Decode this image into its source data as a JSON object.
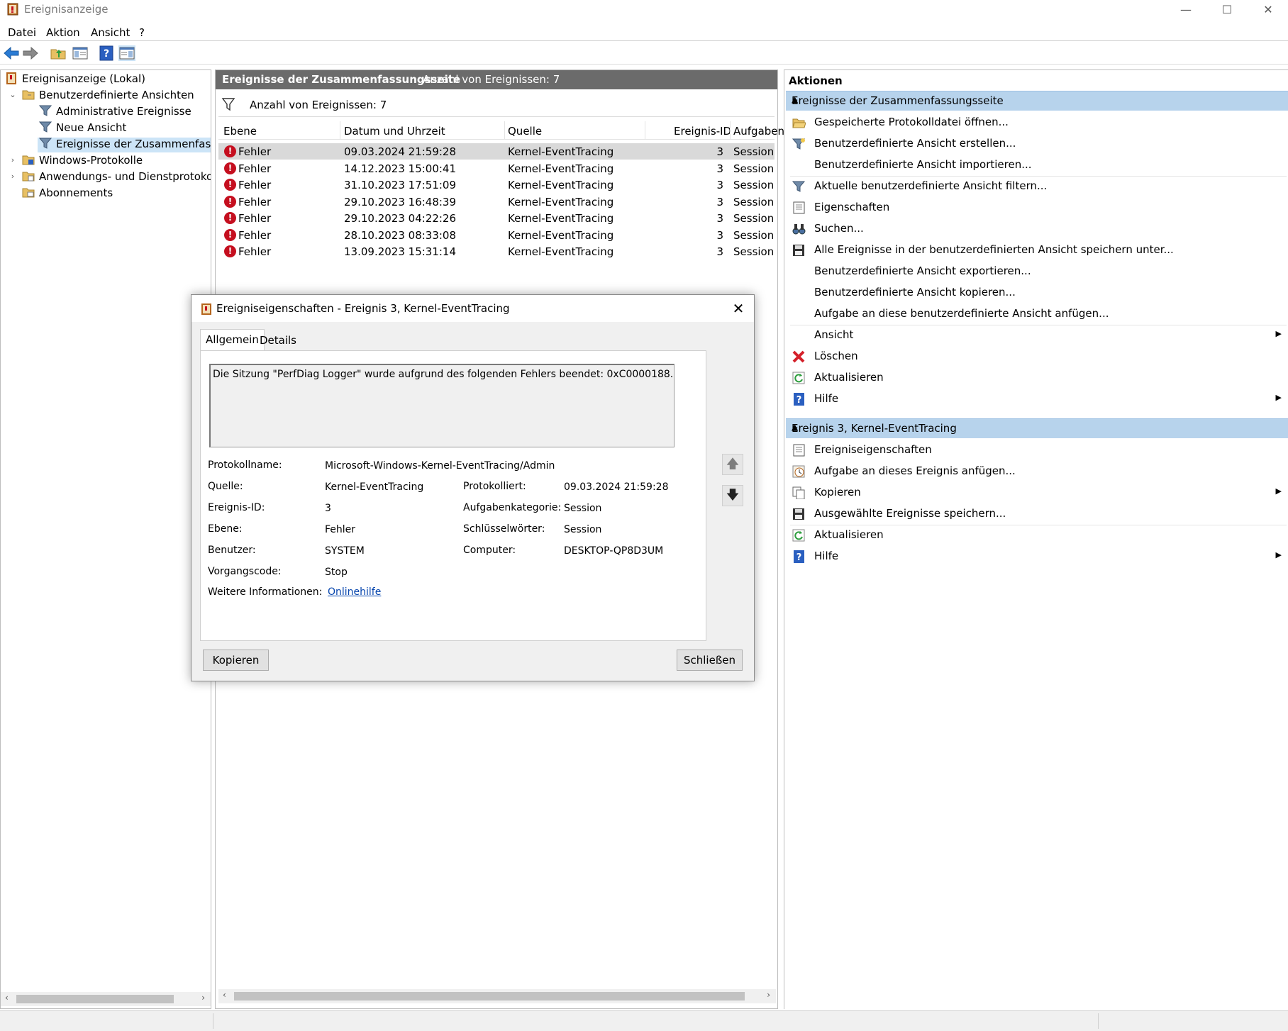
{
  "window": {
    "title": "Ereignisanzeige",
    "minimize_glyph": "—",
    "maximize_glyph": "☐",
    "close_glyph": "✕"
  },
  "menu": [
    "Datei",
    "Aktion",
    "Ansicht",
    "?"
  ],
  "tree": {
    "root": "Ereignisanzeige (Lokal)",
    "custom_views": "Benutzerdefinierte Ansichten",
    "admin_events": "Administrative Ereignisse",
    "new_view": "Neue Ansicht",
    "summary_events": "Ereignisse der Zusammenfassung",
    "windows_logs": "Windows-Protokolle",
    "app_logs": "Anwendungs- und Dienstprotokolle",
    "subscriptions": "Abonnements"
  },
  "middle": {
    "header_title": "Ereignisse der Zusammenfassungsseite",
    "header_count": "Anzahl von Ereignissen: 7",
    "filter_text": "Anzahl von Ereignissen: 7",
    "columns": [
      "Ebene",
      "Datum und Uhrzeit",
      "Quelle",
      "Ereignis-ID",
      "Aufgaben"
    ],
    "rows": [
      {
        "level": "Fehler",
        "datetime": "09.03.2024 21:59:28",
        "source": "Kernel-EventTracing",
        "id": "3",
        "task": "Session"
      },
      {
        "level": "Fehler",
        "datetime": "14.12.2023 15:00:41",
        "source": "Kernel-EventTracing",
        "id": "3",
        "task": "Session"
      },
      {
        "level": "Fehler",
        "datetime": "31.10.2023 17:51:09",
        "source": "Kernel-EventTracing",
        "id": "3",
        "task": "Session"
      },
      {
        "level": "Fehler",
        "datetime": "29.10.2023 16:48:39",
        "source": "Kernel-EventTracing",
        "id": "3",
        "task": "Session"
      },
      {
        "level": "Fehler",
        "datetime": "29.10.2023 04:22:26",
        "source": "Kernel-EventTracing",
        "id": "3",
        "task": "Session"
      },
      {
        "level": "Fehler",
        "datetime": "28.10.2023 08:33:08",
        "source": "Kernel-EventTracing",
        "id": "3",
        "task": "Session"
      },
      {
        "level": "Fehler",
        "datetime": "13.09.2023 15:31:14",
        "source": "Kernel-EventTracing",
        "id": "3",
        "task": "Session"
      }
    ]
  },
  "actions": {
    "header": "Aktionen",
    "section1_title": "Ereignisse der Zusammenfassungsseite",
    "section1": [
      "Gespeicherte Protokolldatei öffnen...",
      "Benutzerdefinierte Ansicht erstellen...",
      "Benutzerdefinierte Ansicht importieren...",
      "Aktuelle benutzerdefinierte Ansicht filtern...",
      "Eigenschaften",
      "Suchen...",
      "Alle Ereignisse in der benutzerdefinierten Ansicht speichern unter...",
      "Benutzerdefinierte Ansicht exportieren...",
      "Benutzerdefinierte Ansicht kopieren...",
      "Aufgabe an diese benutzerdefinierte Ansicht anfügen...",
      "Ansicht",
      "Löschen",
      "Aktualisieren",
      "Hilfe"
    ],
    "section2_title": "Ereignis 3, Kernel-EventTracing",
    "section2": [
      "Ereigniseigenschaften",
      "Aufgabe an dieses Ereignis anfügen...",
      "Kopieren",
      "Ausgewählte Ereignisse speichern...",
      "Aktualisieren",
      "Hilfe"
    ]
  },
  "dialog": {
    "title": "Ereigniseigenschaften - Ereignis 3, Kernel-EventTracing",
    "close_glyph": "✕",
    "tabs": [
      "Allgemein",
      "Details"
    ],
    "message": "Die Sitzung \"PerfDiag Logger\" wurde aufgrund des folgenden Fehlers beendet: 0xC0000188.",
    "fields": {
      "log_name_label": "Protokollname:",
      "log_name": "Microsoft-Windows-Kernel-EventTracing/Admin",
      "source_label": "Quelle:",
      "source": "Kernel-EventTracing",
      "logged_label": "Protokolliert:",
      "logged": "09.03.2024 21:59:28",
      "event_id_label": "Ereignis-ID:",
      "event_id": "3",
      "task_cat_label": "Aufgabenkategorie:",
      "task_cat": "Session",
      "level_label": "Ebene:",
      "level": "Fehler",
      "keywords_label": "Schlüsselwörter:",
      "keywords": "Session",
      "user_label": "Benutzer:",
      "user": "SYSTEM",
      "computer_label": "Computer:",
      "computer": "DESKTOP-QP8D3UM",
      "opcode_label": "Vorgangscode:",
      "opcode": "Stop",
      "more_info_label": "Weitere Informationen:",
      "more_info_link": "Onlinehilfe"
    },
    "copy_button": "Kopieren",
    "close_button": "Schließen"
  }
}
